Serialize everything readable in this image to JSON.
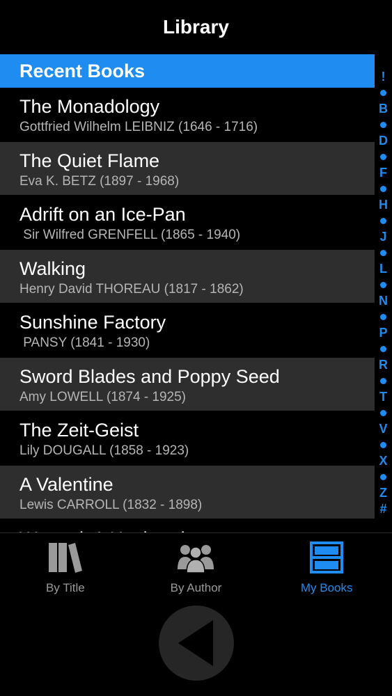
{
  "nav": {
    "title": "Library"
  },
  "section": {
    "label": "Recent Books"
  },
  "books": [
    {
      "title": "The Monadology",
      "author": "Gottfried Wilhelm LEIBNIZ (1646 - 1716)"
    },
    {
      "title": "The Quiet Flame",
      "author": "Eva K. BETZ (1897 - 1968)"
    },
    {
      "title": "Adrift on an Ice-Pan",
      "author": " Sir Wilfred GRENFELL (1865 - 1940)"
    },
    {
      "title": "Walking",
      "author": "Henry David THOREAU (1817 - 1862)"
    },
    {
      "title": "Sunshine Factory",
      "author": " PANSY (1841 - 1930)"
    },
    {
      "title": "Sword Blades and Poppy Seed",
      "author": "Amy LOWELL (1874 - 1925)"
    },
    {
      "title": "The Zeit-Geist",
      "author": "Lily DOUGALL (1858 - 1923)"
    },
    {
      "title": "A Valentine",
      "author": "Lewis CARROLL (1832 - 1898)"
    }
  ],
  "partial_row": {
    "title": "Wanted: A Husband"
  },
  "index": [
    "!",
    "B",
    "D",
    "F",
    "H",
    "J",
    "L",
    "N",
    "P",
    "R",
    "T",
    "V",
    "X",
    "Z",
    "#"
  ],
  "tabs": [
    {
      "label": "By Title",
      "icon": "books-icon"
    },
    {
      "label": "By Author",
      "icon": "people-icon"
    },
    {
      "label": "My Books",
      "icon": "bookshelf-icon"
    }
  ],
  "colors": {
    "accent": "#1f8cf2",
    "row_alt": "#2e2e2e",
    "inactive": "#9a9a9a"
  }
}
